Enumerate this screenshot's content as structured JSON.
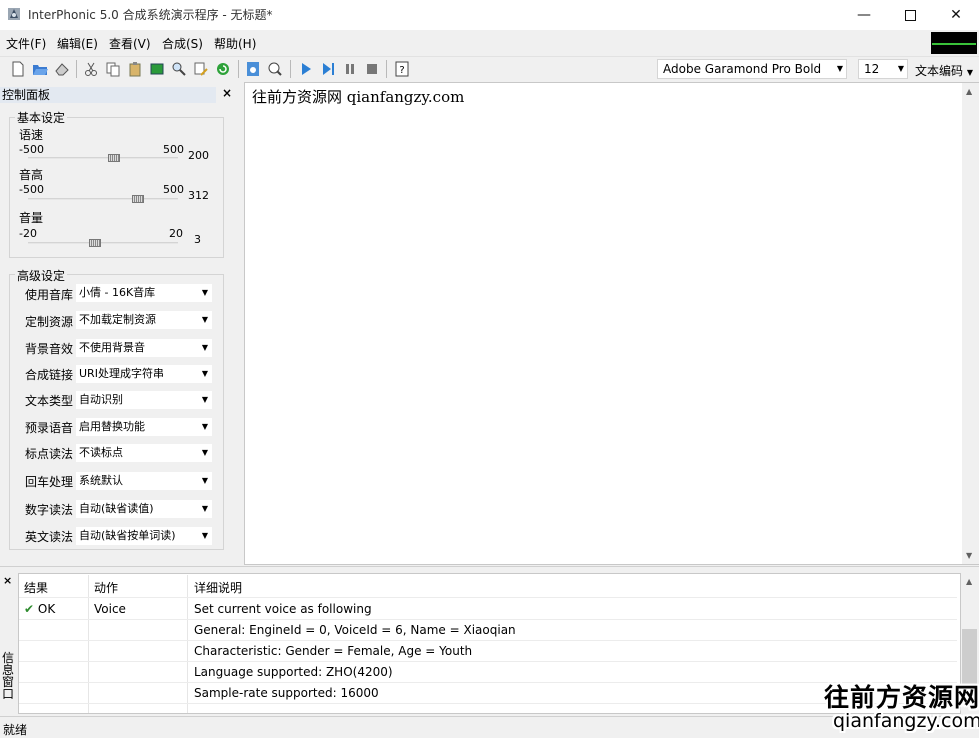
{
  "window": {
    "title": "InterPhonic 5.0 合成系统演示程序 - 无标题*"
  },
  "menu": [
    "文件(F)",
    "编辑(E)",
    "查看(V)",
    "合成(S)",
    "帮助(H)"
  ],
  "toolbar": {
    "font_name": "Adobe Garamond Pro Bold",
    "font_size": "12",
    "encoding_label": "文本编码"
  },
  "control_panel": {
    "title": "控制面板",
    "basic": {
      "legend": "基本设定",
      "sliders": [
        {
          "label": "语速",
          "min": "-500",
          "max": "500",
          "value": "200",
          "level": 0.58
        },
        {
          "label": "音高",
          "min": "-500",
          "max": "500",
          "value": "312",
          "level": 0.75
        },
        {
          "label": "音量",
          "min": "-20",
          "max": "20",
          "value": "3",
          "level": 0.44
        }
      ]
    },
    "advanced": {
      "legend": "高级设定",
      "settings": [
        {
          "label": "使用音库",
          "value": "小倩 - 16K音库"
        },
        {
          "label": "定制资源",
          "value": "不加载定制资源"
        },
        {
          "label": "背景音效",
          "value": "不使用背景音"
        },
        {
          "label": "合成链接",
          "value": "URI处理成字符串"
        },
        {
          "label": "文本类型",
          "value": "自动识别"
        },
        {
          "label": "预录语音",
          "value": "启用替换功能"
        },
        {
          "label": "标点读法",
          "value": "不读标点"
        },
        {
          "label": "回车处理",
          "value": "系统默认"
        },
        {
          "label": "数字读法",
          "value": "自动(缺省读值)"
        },
        {
          "label": "英文读法",
          "value": "自动(缺省按单词读)"
        }
      ]
    }
  },
  "editor": {
    "text": "往前方资源网 qianfangzy.com"
  },
  "info_panel": {
    "side_label": "信息窗口",
    "columns": [
      "结果",
      "动作",
      "详细说明"
    ],
    "rows": [
      {
        "result": "OK",
        "action": "Voice",
        "detail": "Set current voice as following"
      },
      {
        "result": "",
        "action": "",
        "detail": "General: EngineId = 0, VoiceId = 6, Name = Xiaoqian"
      },
      {
        "result": "",
        "action": "",
        "detail": "Characteristic: Gender = Female, Age = Youth"
      },
      {
        "result": "",
        "action": "",
        "detail": "Language supported: ZHO(4200)"
      },
      {
        "result": "",
        "action": "",
        "detail": "Sample-rate supported: 16000"
      }
    ]
  },
  "status": {
    "text": "就绪"
  },
  "watermark": {
    "line1": "往前方资源网",
    "line2": "qianfangzy.com"
  },
  "colors": {
    "meter_bg": "#000000",
    "meter_line": "#39c239",
    "panel_header": "#e3e9f1"
  }
}
